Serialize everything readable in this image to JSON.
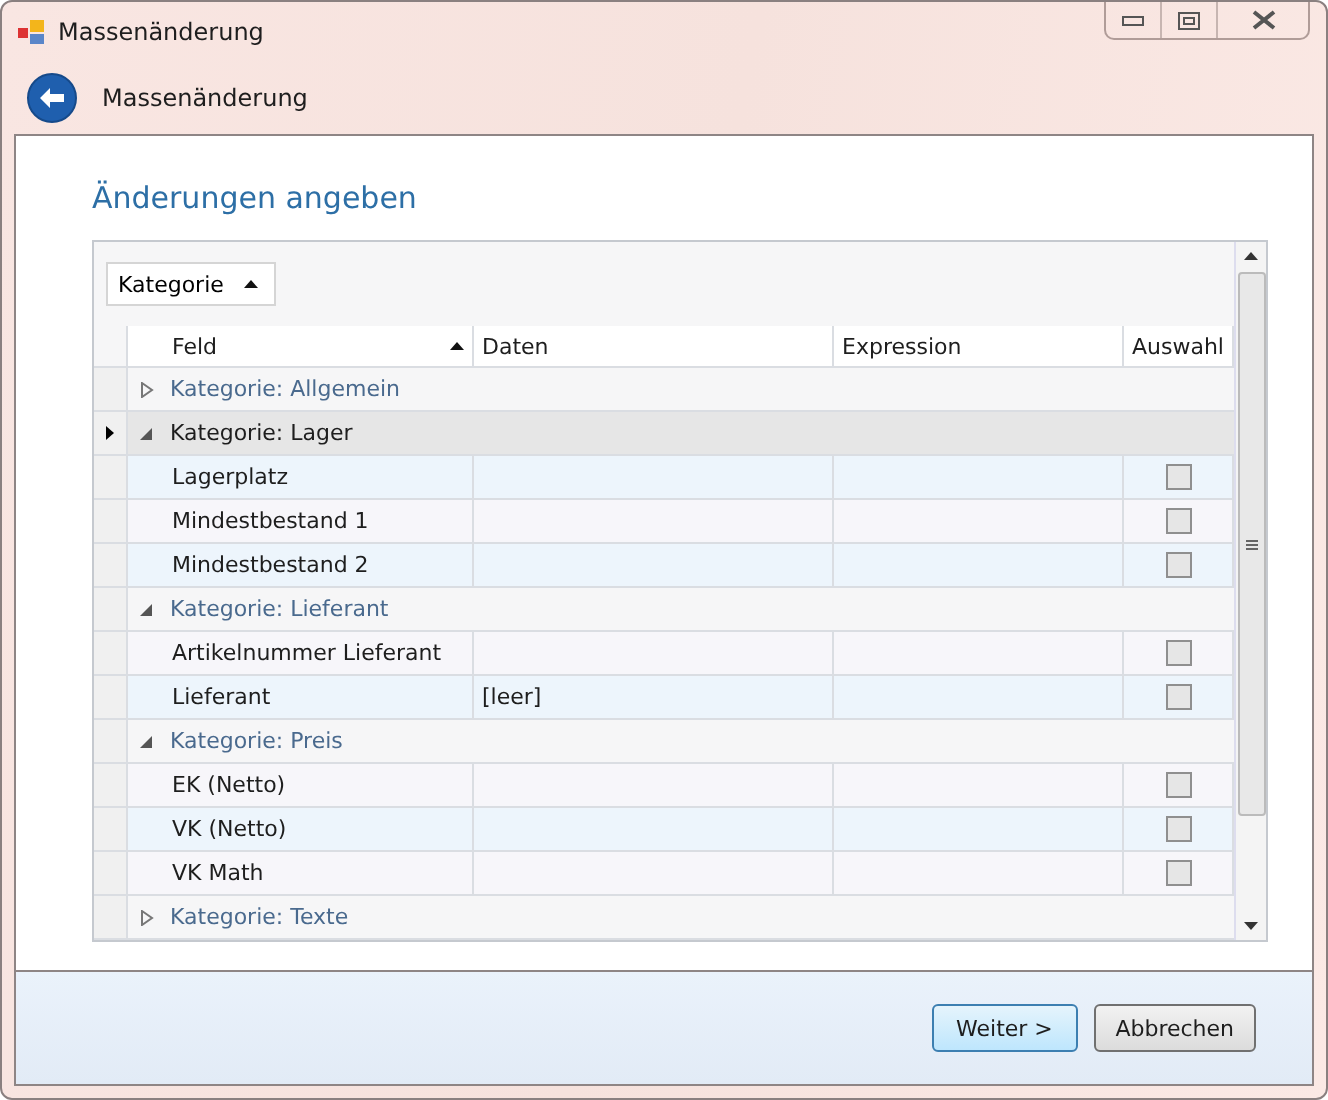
{
  "window": {
    "title": "Massenänderung"
  },
  "nav": {
    "title": "Massenänderung"
  },
  "heading": "Änderungen angeben",
  "group_panel": {
    "button": "Kategorie"
  },
  "table": {
    "columns": [
      "Feld",
      "Daten",
      "Expression",
      "Auswahl"
    ],
    "groups": [
      {
        "label": "Kategorie: Allgemein",
        "expanded": false,
        "selected": false
      },
      {
        "label": "Kategorie: Lager",
        "expanded": true,
        "selected": true,
        "rows": [
          {
            "feld": "Lagerplatz",
            "checked": false
          },
          {
            "feld": "Mindestbestand 1",
            "checked": false
          },
          {
            "feld": "Mindestbestand 2",
            "checked": false
          }
        ]
      },
      {
        "label": "Kategorie: Lieferant",
        "expanded": true,
        "selected": false,
        "rows": [
          {
            "feld": "Artikelnummer Lieferant",
            "checked": false
          },
          {
            "feld": "Lieferant",
            "daten": "[leer]",
            "checked": false
          }
        ]
      },
      {
        "label": "Kategorie: Preis",
        "expanded": true,
        "selected": false,
        "rows": [
          {
            "feld": "EK (Netto)",
            "checked": false
          },
          {
            "feld": "VK (Netto)",
            "checked": false
          },
          {
            "feld": "VK Math",
            "checked": false
          }
        ]
      },
      {
        "label": "Kategorie: Texte",
        "expanded": false,
        "selected": false
      }
    ]
  },
  "buttons": [
    "Weiter >",
    "Abbrechen"
  ]
}
